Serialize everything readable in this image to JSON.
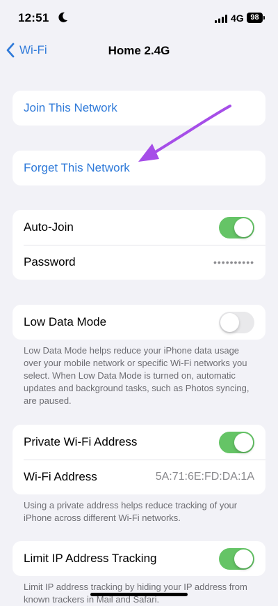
{
  "status_bar": {
    "time": "12:51",
    "network": "4G",
    "battery": "98"
  },
  "nav": {
    "back_label": "Wi-Fi",
    "title": "Home 2.4G"
  },
  "actions": {
    "join": "Join This Network",
    "forget": "Forget This Network"
  },
  "auto_join": {
    "label": "Auto-Join",
    "enabled": true
  },
  "password": {
    "label": "Password",
    "value": "••••••••••"
  },
  "low_data": {
    "label": "Low Data Mode",
    "enabled": false,
    "footnote": "Low Data Mode helps reduce your iPhone data usage over your mobile network or specific Wi-Fi networks you select. When Low Data Mode is turned on, automatic updates and background tasks, such as Photos syncing, are paused."
  },
  "private_address": {
    "label": "Private Wi-Fi Address",
    "enabled": true,
    "wifi_address_label": "Wi-Fi Address",
    "wifi_address_value": "5A:71:6E:FD:DA:1A",
    "footnote": "Using a private address helps reduce tracking of your iPhone across different Wi-Fi networks."
  },
  "limit_ip": {
    "label": "Limit IP Address Tracking",
    "enabled": true,
    "footnote": "Limit IP address tracking by hiding your IP address from known trackers in Mail and Safari."
  },
  "colors": {
    "accent": "#2f7ad9",
    "toggle_on": "#65c466",
    "annotation_arrow": "#a64ee8"
  },
  "icons": [
    "moon-icon",
    "signal-icon",
    "battery-icon",
    "chevron-left-icon",
    "annotation-arrow"
  ]
}
